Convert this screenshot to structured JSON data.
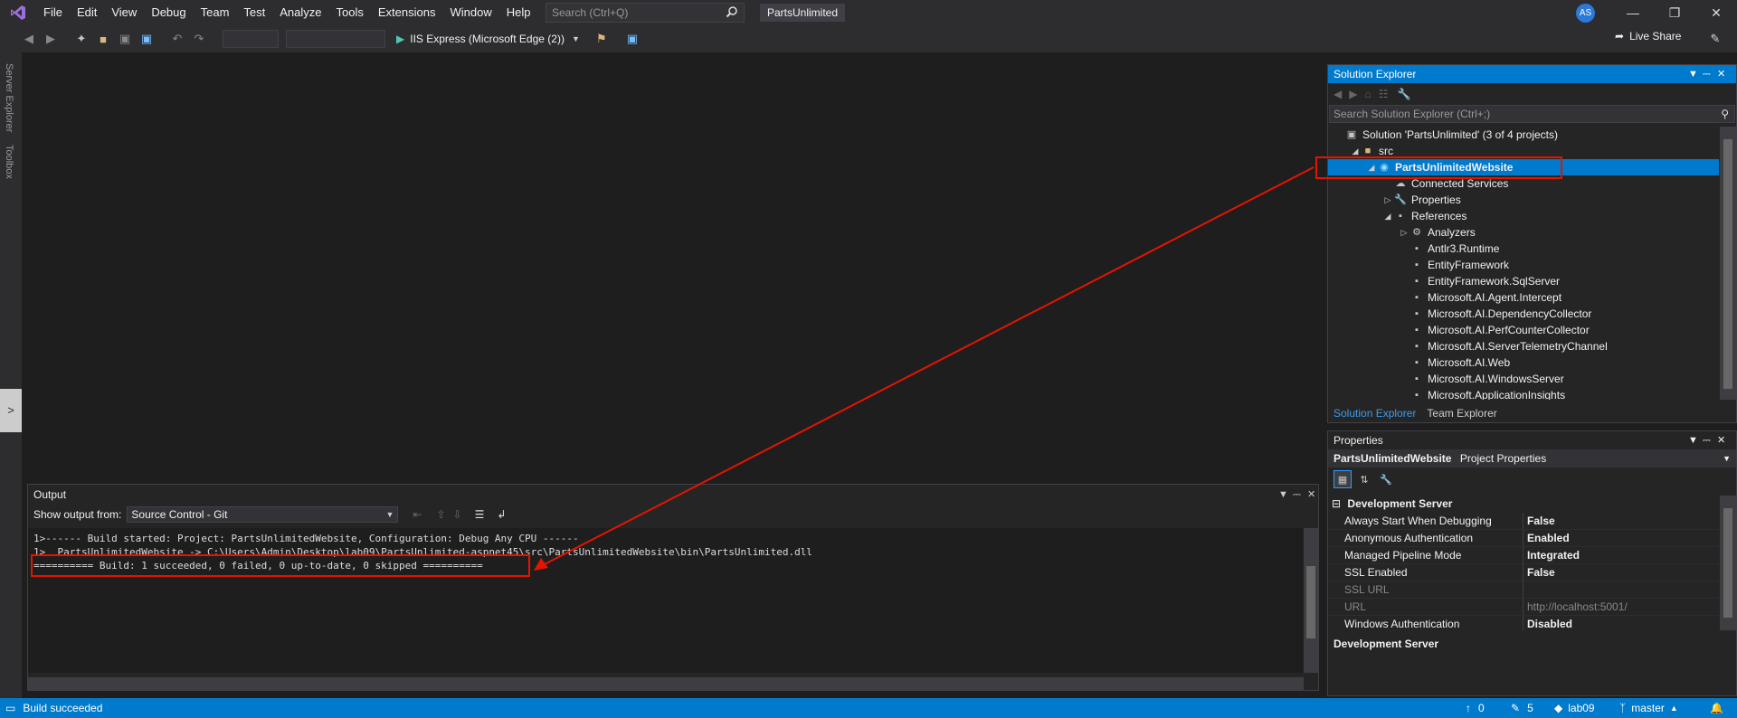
{
  "menubar": {
    "items": [
      "File",
      "Edit",
      "View",
      "Debug",
      "Team",
      "Test",
      "Analyze",
      "Tools",
      "Extensions",
      "Window",
      "Help"
    ],
    "search_placeholder": "Search (Ctrl+Q)",
    "solution_name": "PartsUnlimited",
    "avatar_initials": "AS"
  },
  "toolbar": {
    "run_target": "IIS Express (Microsoft Edge (2))",
    "live_share_label": "Live Share"
  },
  "left_tabs": {
    "server_explorer": "Server Explorer",
    "toolbox": "Toolbox",
    "expand_glyph": ">"
  },
  "output": {
    "title": "Output",
    "show_from_label": "Show output from:",
    "source": "Source Control - Git",
    "lines": [
      "1>------ Build started: Project: PartsUnlimitedWebsite, Configuration: Debug Any CPU ------",
      "1>  PartsUnlimitedWebsite -> C:\\Users\\Admin\\Desktop\\lab09\\PartsUnlimited-aspnet45\\src\\PartsUnlimitedWebsite\\bin\\PartsUnlimited.dll",
      "========== Build: 1 succeeded, 0 failed, 0 up-to-date, 0 skipped =========="
    ]
  },
  "solution_explorer": {
    "title": "Solution Explorer",
    "search_placeholder": "Search Solution Explorer (Ctrl+;)",
    "tree": [
      {
        "label": "Solution 'PartsUnlimited' (3 of 4 projects)",
        "depth": 0,
        "twisty": "",
        "icon": "solution-icon"
      },
      {
        "label": "src",
        "depth": 1,
        "twisty": "open",
        "icon": "folder-icon"
      },
      {
        "label": "PartsUnlimitedWebsite",
        "depth": 2,
        "twisty": "open",
        "icon": "web-project-icon",
        "selected": true
      },
      {
        "label": "Connected Services",
        "depth": 3,
        "twisty": "",
        "icon": "cloud-icon"
      },
      {
        "label": "Properties",
        "depth": 3,
        "twisty": "closed",
        "icon": "wrench-icon"
      },
      {
        "label": "References",
        "depth": 3,
        "twisty": "open",
        "icon": "references-icon"
      },
      {
        "label": "Analyzers",
        "depth": 4,
        "twisty": "closed",
        "icon": "analyzer-icon"
      },
      {
        "label": "Antlr3.Runtime",
        "depth": 4,
        "twisty": "",
        "icon": "reference-icon"
      },
      {
        "label": "EntityFramework",
        "depth": 4,
        "twisty": "",
        "icon": "reference-icon"
      },
      {
        "label": "EntityFramework.SqlServer",
        "depth": 4,
        "twisty": "",
        "icon": "reference-icon"
      },
      {
        "label": "Microsoft.AI.Agent.Intercept",
        "depth": 4,
        "twisty": "",
        "icon": "reference-icon"
      },
      {
        "label": "Microsoft.AI.DependencyCollector",
        "depth": 4,
        "twisty": "",
        "icon": "reference-icon"
      },
      {
        "label": "Microsoft.AI.PerfCounterCollector",
        "depth": 4,
        "twisty": "",
        "icon": "reference-icon"
      },
      {
        "label": "Microsoft.AI.ServerTelemetryChannel",
        "depth": 4,
        "twisty": "",
        "icon": "reference-icon"
      },
      {
        "label": "Microsoft.AI.Web",
        "depth": 4,
        "twisty": "",
        "icon": "reference-icon"
      },
      {
        "label": "Microsoft.AI.WindowsServer",
        "depth": 4,
        "twisty": "",
        "icon": "reference-icon"
      },
      {
        "label": "Microsoft.ApplicationInsights",
        "depth": 4,
        "twisty": "",
        "icon": "reference-icon"
      }
    ],
    "tabs": [
      "Solution Explorer",
      "Team Explorer"
    ]
  },
  "properties": {
    "title": "Properties",
    "object_name": "PartsUnlimitedWebsite",
    "object_type": "Project Properties",
    "category": "Development Server",
    "rows": [
      {
        "name": "Always Start When Debugging",
        "value": "False",
        "dim": false
      },
      {
        "name": "Anonymous Authentication",
        "value": "Enabled",
        "dim": false
      },
      {
        "name": "Managed Pipeline Mode",
        "value": "Integrated",
        "dim": false
      },
      {
        "name": "SSL Enabled",
        "value": "False",
        "dim": false
      },
      {
        "name": "SSL URL",
        "value": "",
        "dim": true
      },
      {
        "name": "URL",
        "value": "http://localhost:5001/",
        "dim": true
      },
      {
        "name": "Windows Authentication",
        "value": "Disabled",
        "dim": false
      }
    ],
    "description_title": "Development Server"
  },
  "statusbar": {
    "message": "Build succeeded",
    "pending_up": "0",
    "pending_changes": "5",
    "repo": "lab09",
    "branch": "master"
  },
  "colors": {
    "accent": "#007acc",
    "annotation": "#e51400",
    "background": "#1e1e1e"
  }
}
